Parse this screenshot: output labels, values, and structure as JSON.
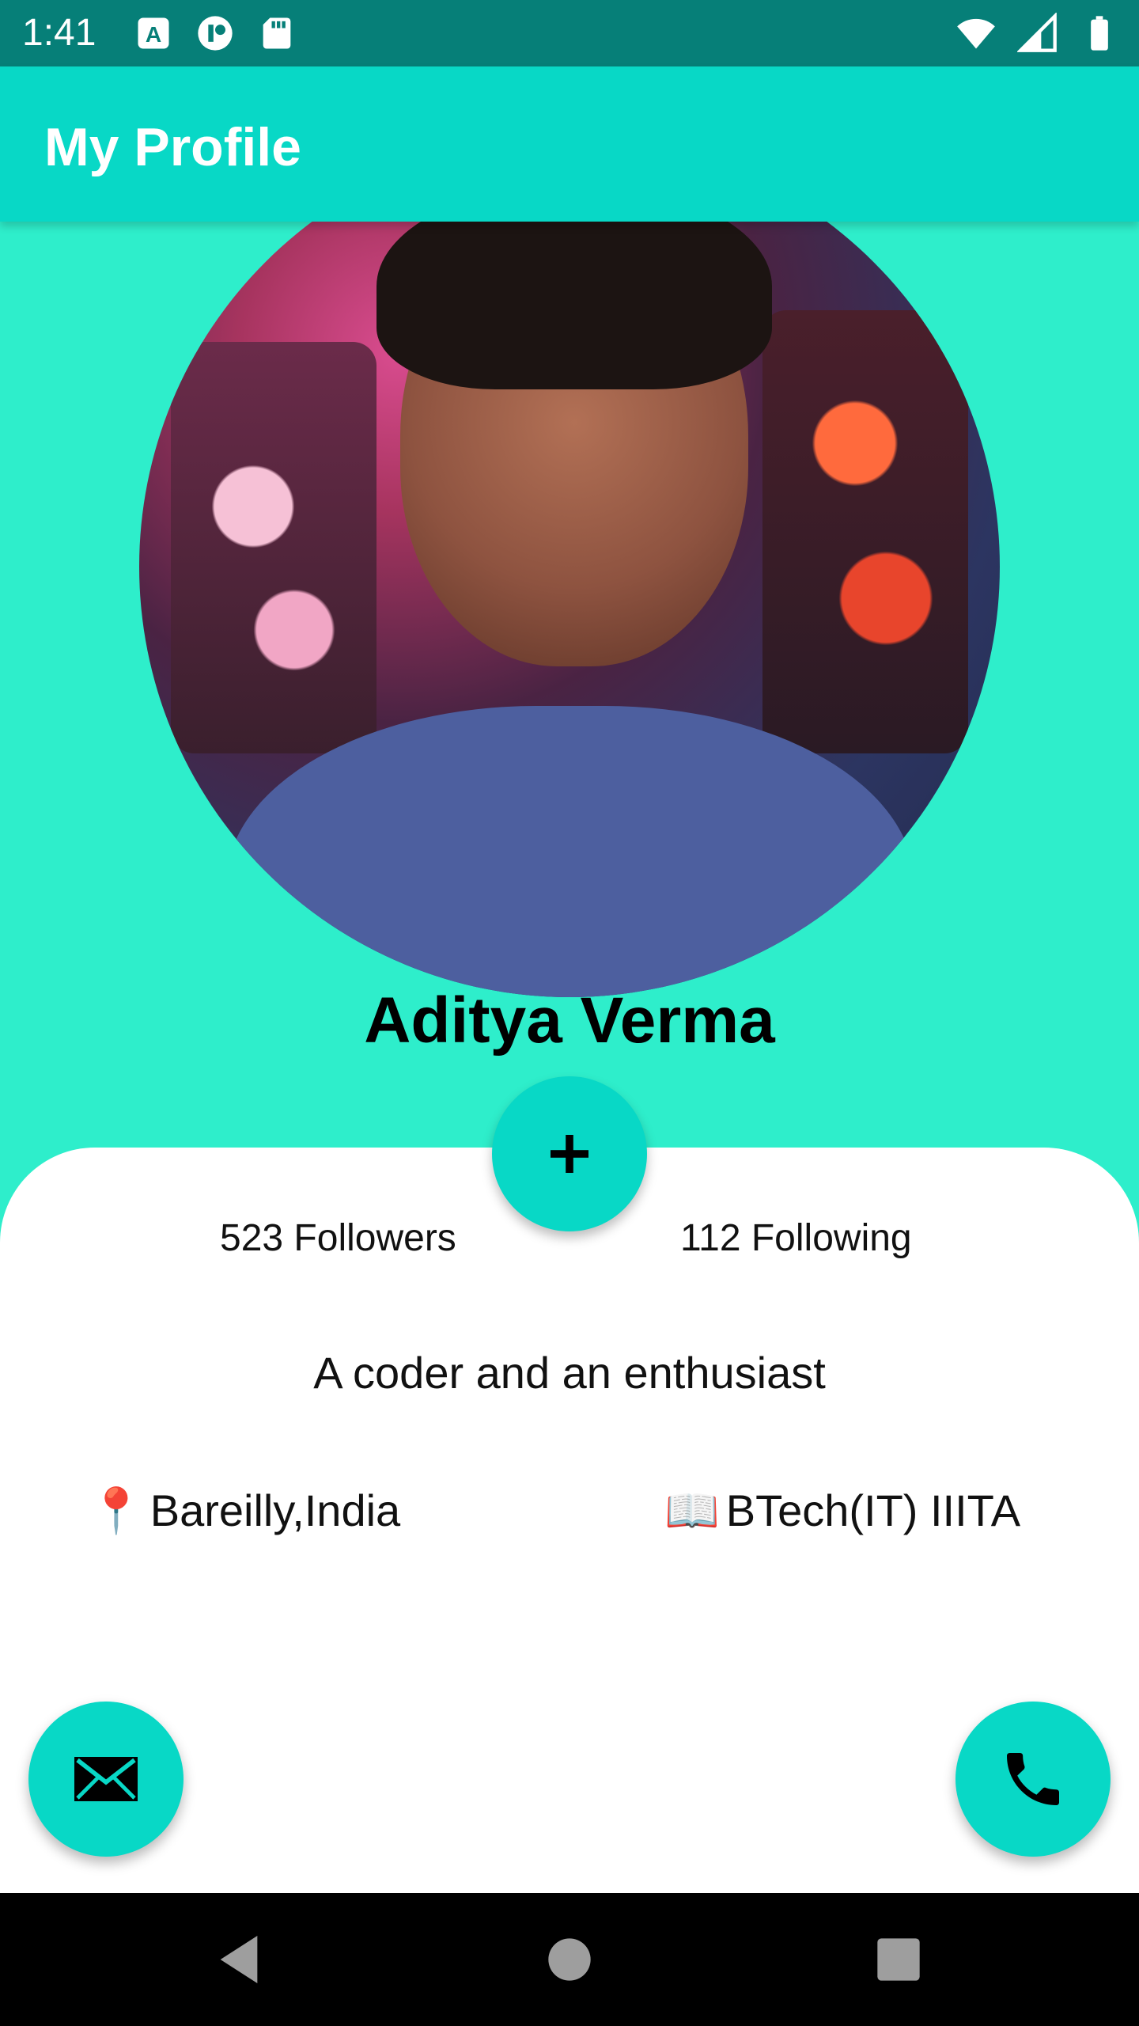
{
  "status_bar": {
    "time": "1:41",
    "icons_left": [
      "a-icon",
      "app-icon",
      "sd-card-icon"
    ],
    "icons_right": [
      "wifi-icon",
      "cell-signal-icon",
      "battery-icon"
    ]
  },
  "app_bar": {
    "title": "My Profile"
  },
  "profile": {
    "name": "Aditya Verma",
    "followers": "523 Followers",
    "following": "112 Following",
    "bio": "A coder and an enthusiast",
    "location_icon": "📍",
    "location": "Bareilly,India",
    "education_icon": "📖",
    "education": "BTech(IT) IIITA"
  },
  "actions": {
    "add_icon": "plus-icon",
    "mail_icon": "mail-icon",
    "call_icon": "phone-icon"
  },
  "colors": {
    "status_bar": "#067f78",
    "app_bar": "#08d8c6",
    "header_bg": "#2eeecb",
    "fab": "#08d8c6"
  }
}
